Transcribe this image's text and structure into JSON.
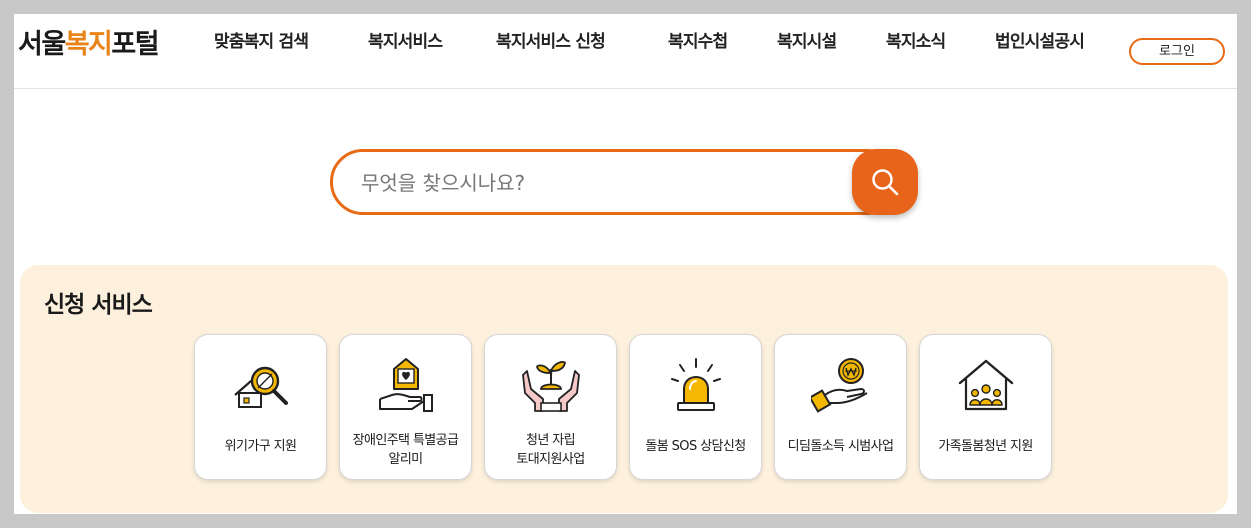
{
  "header": {
    "logo_part1": "서울",
    "logo_part2": "복지",
    "logo_part3": "포털",
    "nav": [
      {
        "label": "맞춤복지 검색"
      },
      {
        "label": "복지서비스"
      },
      {
        "label": "복지서비스 신청"
      },
      {
        "label": "복지수첩"
      },
      {
        "label": "복지시설"
      },
      {
        "label": "복지소식"
      },
      {
        "label": "법인시설공시"
      }
    ],
    "login_label": "로그인"
  },
  "search": {
    "placeholder": "무엇을 찾으시나요?",
    "value": ""
  },
  "services": {
    "title": "신청 서비스",
    "cards": [
      {
        "label": "위기가구 지원",
        "icon": "magnifier-house-icon"
      },
      {
        "label_line1": "장애인주택 특별공급",
        "label_line2": "알리미",
        "icon": "hand-house-heart-icon"
      },
      {
        "label_line1": "청년 자립",
        "label_line2": "토대지원사업",
        "icon": "hands-sprout-icon"
      },
      {
        "label": "돌봄 SOS 상담신청",
        "icon": "siren-icon"
      },
      {
        "label": "디딤돌소득 시범사업",
        "icon": "hand-coin-icon"
      },
      {
        "label": "가족돌봄청년 지원",
        "icon": "house-family-icon"
      }
    ]
  },
  "colors": {
    "accent": "#e86a14",
    "logo_accent": "#e8841a",
    "panel_bg": "#fdf1dd",
    "icon_yellow": "#f5b800"
  }
}
